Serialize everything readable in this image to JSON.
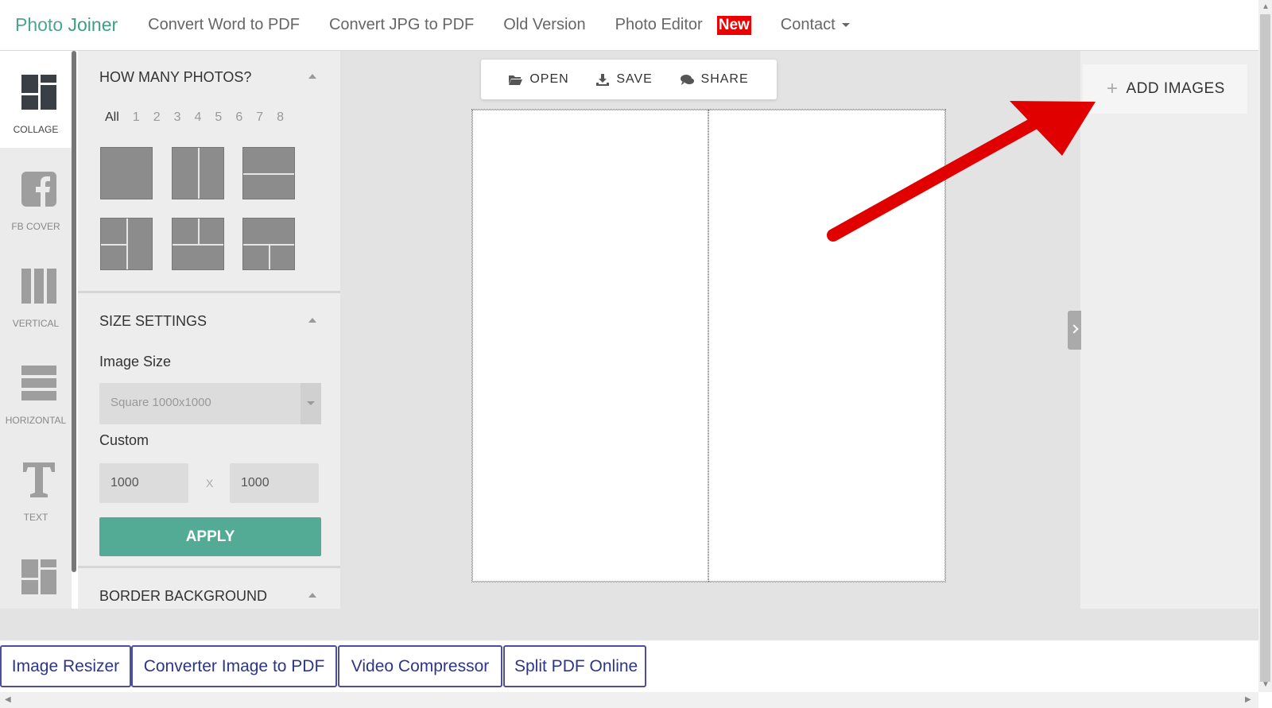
{
  "nav": {
    "brand_part1": "Photo ",
    "brand_part2": "Joiner",
    "links": [
      "Convert Word to PDF",
      "Convert JPG to PDF",
      "Old Version",
      "Photo Editor"
    ],
    "new_badge": "New",
    "contact": "Contact"
  },
  "iconbar": {
    "items": [
      {
        "label": "COLLAGE",
        "icon": "collage-icon"
      },
      {
        "label": "FB COVER",
        "icon": "facebook-icon"
      },
      {
        "label": "VERTICAL",
        "icon": "vertical-icon"
      },
      {
        "label": "HORIZONTAL",
        "icon": "horizontal-icon"
      },
      {
        "label": "TEXT",
        "icon": "text-icon"
      },
      {
        "label": "",
        "icon": "template-icon"
      }
    ]
  },
  "panel": {
    "how_many_title": "HOW MANY PHOTOS?",
    "counts": [
      "All",
      "1",
      "2",
      "3",
      "4",
      "5",
      "6",
      "7",
      "8"
    ],
    "selected_count": "All",
    "size_title": "SIZE SETTINGS",
    "image_size_label": "Image Size",
    "image_size_value": "Square 1000x1000",
    "custom_label": "Custom",
    "width_value": "1000",
    "x_sep": "X",
    "height_value": "1000",
    "apply_label": "APPLY",
    "border_title": "BORDER BACKGROUND"
  },
  "toolbar": {
    "open": "OPEN",
    "save": "SAVE",
    "share": "SHARE"
  },
  "right": {
    "add_images": "ADD IMAGES"
  },
  "footer": {
    "buttons": [
      "Image Resizer",
      "Converter Image to PDF",
      "Video Compressor",
      "Split PDF Online"
    ]
  },
  "colors": {
    "brand": "#4aa68e",
    "apply": "#53ab96",
    "new_badge": "#e00000",
    "annotation_arrow": "#e00000",
    "footer_border": "#4e4f9a"
  }
}
